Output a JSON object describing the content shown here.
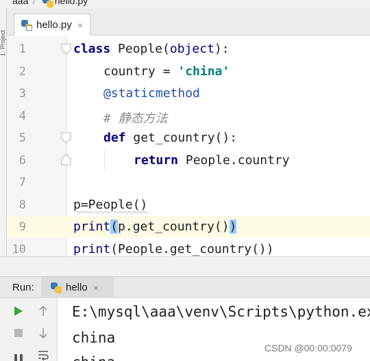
{
  "breadcrumb": {
    "folder": "aaa",
    "separator": "/",
    "file": "hello.py"
  },
  "left_strip": {
    "vertical_tab": "1: Project"
  },
  "editor_tab": {
    "label": "hello.py",
    "close": "×"
  },
  "editor": {
    "line_numbers": [
      "1",
      "2",
      "3",
      "4",
      "5",
      "6",
      "7",
      "8",
      "9",
      "10"
    ],
    "lines": {
      "l1": {
        "kw": "class",
        "name": " People",
        "paren_open": "(",
        "base": "object",
        "paren_close": "):"
      },
      "l2": {
        "var": "country = ",
        "str": "'china'"
      },
      "l3": {
        "deco": "@staticmethod"
      },
      "l4": {
        "comment": "# 静态方法"
      },
      "l5": {
        "kw": "def",
        "rest": " get_country():"
      },
      "l6": {
        "kw": "return",
        "rest": " People.country"
      },
      "l8": {
        "text": "p=People()"
      },
      "l9": {
        "fn": "print",
        "open": "(",
        "mid": "p.get_country()",
        "close": ")"
      },
      "l10": {
        "fn": "print",
        "rest": "(People.get_country())"
      }
    }
  },
  "run_panel": {
    "title": "Run:",
    "tab_label": "hello",
    "tab_close": "×",
    "output": [
      "E:\\mysql\\aaa\\venv\\Scripts\\python.exe",
      "china",
      "china"
    ]
  },
  "watermark": "CSDN @00:00:0079",
  "colors": {
    "keyword": "#000080",
    "string": "#008080",
    "decorator": "#1f4fb4",
    "comment": "#8c8c8c",
    "run_green": "#3aa53a",
    "current_line": "#fdfbe4"
  }
}
